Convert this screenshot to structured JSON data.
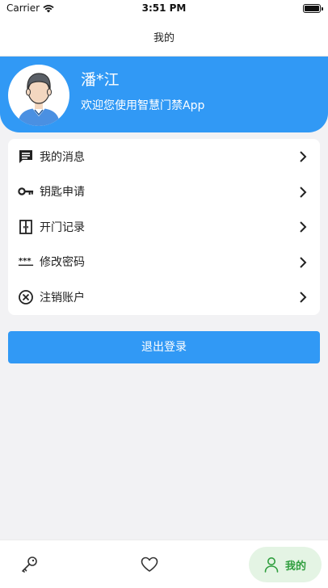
{
  "status_bar": {
    "carrier": "Carrier",
    "time": "3:51 PM"
  },
  "nav": {
    "title": "我的"
  },
  "profile": {
    "name": "潘*江",
    "welcome": "欢迎您使用智慧门禁App"
  },
  "menu": {
    "items": [
      {
        "label": "我的消息",
        "icon": "message-icon"
      },
      {
        "label": "钥匙申请",
        "icon": "key-icon"
      },
      {
        "label": "开门记录",
        "icon": "door-icon"
      },
      {
        "label": "修改密码",
        "icon": "password-icon"
      },
      {
        "label": "注销账户",
        "icon": "cancel-account-icon"
      }
    ]
  },
  "logout": {
    "label": "退出登录"
  },
  "tab_bar": {
    "tabs": [
      {
        "icon": "key-icon"
      },
      {
        "icon": "heart-icon"
      },
      {
        "icon": "person-icon",
        "label": "我的",
        "active": true
      }
    ]
  },
  "colors": {
    "primary": "#3199f5",
    "tab_active": "#2f9e3e",
    "tab_active_bg": "#e4f4e4"
  }
}
